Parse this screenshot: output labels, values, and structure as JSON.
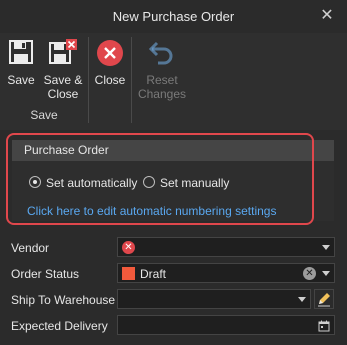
{
  "window": {
    "title": "New Purchase Order",
    "close_glyph": "✕"
  },
  "ribbon": {
    "save_label": "Save",
    "save_close_label": "Save &\nClose",
    "close_label": "Close",
    "reset_label": "Reset\nChanges",
    "group_label": "Save"
  },
  "numbering": {
    "header": "Purchase Order",
    "option_auto": "Set automatically",
    "option_manual": "Set manually",
    "selected": "Set automatically",
    "link": "Click here to edit automatic numbering settings"
  },
  "form": {
    "vendor_label": "Vendor",
    "vendor_value": "",
    "order_status_label": "Order Status",
    "order_status_value": "Draft",
    "ship_to_label": "Ship To Warehouse",
    "ship_to_value": "",
    "expected_delivery_label": "Expected Delivery",
    "expected_delivery_value": ""
  },
  "colors": {
    "highlight": "#e0474c",
    "link": "#5aa8f0",
    "status_draft": "#f25a3c",
    "icon_blue": "#6fa8dc"
  },
  "icons": {
    "save": "floppy-disk-icon",
    "save_close": "floppy-disk-close-icon",
    "close": "close-circle-icon",
    "reset": "undo-arrow-icon",
    "error": "error-icon",
    "clear": "clear-icon",
    "edit": "pencil-icon",
    "calendar": "calendar-icon"
  }
}
